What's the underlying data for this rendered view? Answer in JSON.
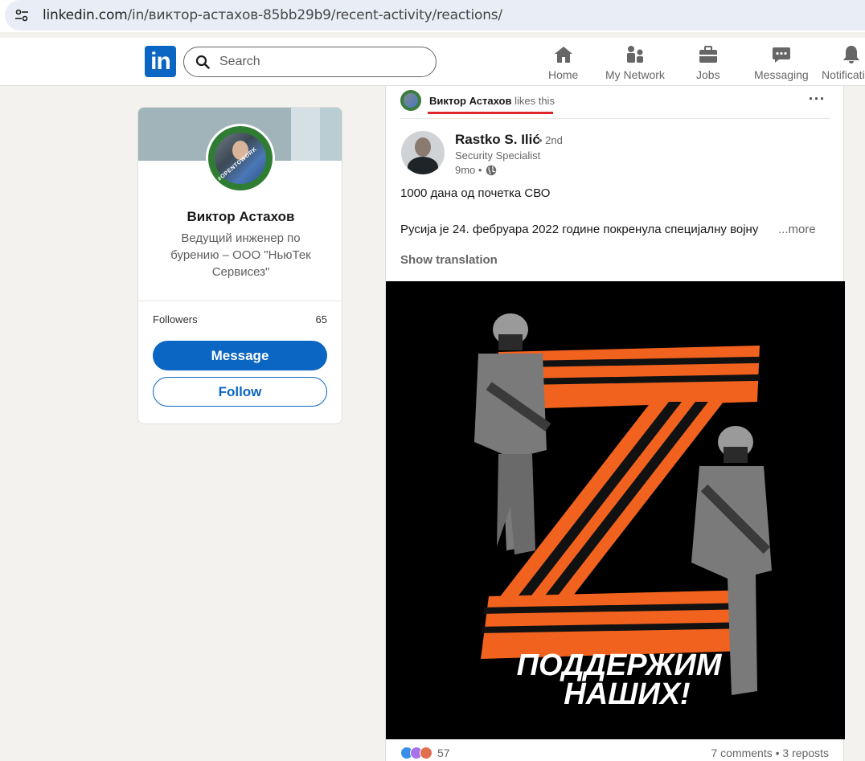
{
  "browser": {
    "url_host": "linkedin.com",
    "url_path": "/in/виктор-астахов-85bb29b9/recent-activity/reactions/"
  },
  "nav": {
    "logo": "in",
    "search_placeholder": "Search",
    "items": [
      {
        "label": "Home",
        "icon": "home-icon"
      },
      {
        "label": "My Network",
        "icon": "network-icon"
      },
      {
        "label": "Jobs",
        "icon": "briefcase-icon"
      },
      {
        "label": "Messaging",
        "icon": "chat-icon"
      },
      {
        "label": "Notifications",
        "icon": "bell-icon"
      }
    ]
  },
  "profile": {
    "name": "Виктор Астахов",
    "headline": "Ведущий инженер по бурению – ООО \"НьюТек Сервисез\"",
    "frame_text": "#OPENTOWORK",
    "followers_label": "Followers",
    "followers_count": "65",
    "message_label": "Message",
    "follow_label": "Follow"
  },
  "post": {
    "reactor_name": "Виктор Астахов",
    "reactor_action": "likes this",
    "menu": "···",
    "author_name": "Rastko S. Ilić",
    "author_degree": "• 2nd",
    "author_title": "Security Specialist",
    "time": "9mo •",
    "text_line1": "1000 дана од почетка СВО",
    "text_line2": "Русија је 24. фебруара 2022 године покренула специјалну војну",
    "more_label": "...more",
    "show_translation": "Show translation",
    "image_caption_line1": "ПОДДЕРЖИМ",
    "image_caption_line2": "НАШИХ!",
    "reactions_count": "57",
    "comments_reposts": "7 comments • 3 reposts"
  },
  "colors": {
    "linkedin_blue": "#0a66c2",
    "page_bg": "#f3f2ef",
    "highlight_red": "#e0262d",
    "ribbon_orange": "#f2621f"
  }
}
